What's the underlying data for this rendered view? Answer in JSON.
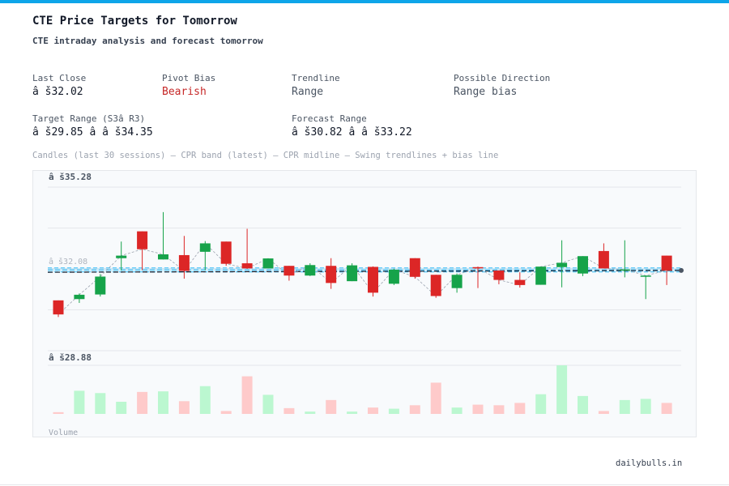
{
  "header": {
    "title": "CTE Price Targets for Tomorrow",
    "subtitle": "CTE intraday analysis and forecast tomorrow"
  },
  "stats": {
    "last_close_label": "Last Close",
    "last_close_value": "â š32.02",
    "pivot_bias_label": "Pivot Bias",
    "pivot_bias_value": "Bearish",
    "trendline_label": "Trendline",
    "trendline_value": "Range",
    "direction_label": "Possible Direction",
    "direction_value": "Range bias",
    "target_range_label": "Target Range (S3â  R3)",
    "target_range_value": "â š29.85 â   â š34.35",
    "forecast_range_label": "Forecast Range",
    "forecast_range_value": "â š30.82 â   â š33.22"
  },
  "caption": "Candles (last 30 sessions) – CPR band (latest) – CPR midline – Swing trendlines + bias line",
  "footer": "dailybulls.in",
  "colors": {
    "up": "#16a34a",
    "down": "#dc2626",
    "up_volume": "#bbf7d0",
    "down_volume": "#fecaca",
    "cpr": "#38bdf8",
    "accent": "#0ea5e9"
  },
  "chart_data": {
    "type": "candlestick",
    "y_top_label": "â š35.28",
    "y_bottom_label": "â š28.88",
    "ylim": [
      28.88,
      35.28
    ],
    "last_price_label": "â š32.08",
    "volume_label": "Volume",
    "grid": true,
    "cpr_band": [
      31.96,
      32.12
    ],
    "cpr_mid": 32.04,
    "bias_line": [
      31.95,
      32.02
    ],
    "candles": [
      {
        "o": 30.85,
        "h": 30.68,
        "l": 30.2,
        "c": 30.3,
        "v": 3
      },
      {
        "o": 30.9,
        "h": 31.12,
        "l": 30.75,
        "c": 31.07,
        "v": 40
      },
      {
        "o": 31.08,
        "h": 31.88,
        "l": 31.0,
        "c": 31.78,
        "v": 36
      },
      {
        "o": 32.5,
        "h": 33.15,
        "l": 32.02,
        "c": 32.6,
        "v": 21
      },
      {
        "o": 33.55,
        "h": 33.55,
        "l": 32.03,
        "c": 32.85,
        "v": 38
      },
      {
        "o": 32.45,
        "h": 34.3,
        "l": 32.45,
        "c": 32.65,
        "v": 39
      },
      {
        "o": 32.62,
        "h": 33.37,
        "l": 31.7,
        "c": 32.0,
        "v": 22
      },
      {
        "o": 32.75,
        "h": 33.17,
        "l": 32.03,
        "c": 33.08,
        "v": 48
      },
      {
        "o": 33.15,
        "h": 33.15,
        "l": 32.2,
        "c": 32.28,
        "v": 5
      },
      {
        "o": 32.3,
        "h": 33.65,
        "l": 32.08,
        "c": 32.1,
        "v": 65
      },
      {
        "o": 32.1,
        "h": 32.49,
        "l": 32.1,
        "c": 32.49,
        "v": 33
      },
      {
        "o": 32.2,
        "h": 32.2,
        "l": 31.62,
        "c": 31.82,
        "v": 10
      },
      {
        "o": 31.82,
        "h": 32.3,
        "l": 31.8,
        "c": 32.23,
        "v": 4
      },
      {
        "o": 32.2,
        "h": 32.5,
        "l": 31.3,
        "c": 31.53,
        "v": 24
      },
      {
        "o": 31.6,
        "h": 32.3,
        "l": 31.6,
        "c": 32.22,
        "v": 4
      },
      {
        "o": 32.16,
        "h": 32.18,
        "l": 31.0,
        "c": 31.15,
        "v": 11
      },
      {
        "o": 31.5,
        "h": 32.09,
        "l": 31.45,
        "c": 32.05,
        "v": 9
      },
      {
        "o": 32.5,
        "h": 32.5,
        "l": 31.7,
        "c": 31.77,
        "v": 15
      },
      {
        "o": 31.85,
        "h": 31.85,
        "l": 30.95,
        "c": 31.02,
        "v": 54
      },
      {
        "o": 31.33,
        "h": 31.9,
        "l": 31.15,
        "c": 31.85,
        "v": 11
      },
      {
        "o": 32.15,
        "h": 32.17,
        "l": 31.33,
        "c": 32.12,
        "v": 16
      },
      {
        "o": 32.02,
        "h": 32.02,
        "l": 31.48,
        "c": 31.65,
        "v": 15
      },
      {
        "o": 31.65,
        "h": 31.95,
        "l": 31.35,
        "c": 31.45,
        "v": 19
      },
      {
        "o": 31.46,
        "h": 32.17,
        "l": 31.46,
        "c": 32.17,
        "v": 34
      },
      {
        "o": 32.15,
        "h": 33.2,
        "l": 31.36,
        "c": 32.32,
        "v": 84
      },
      {
        "o": 31.9,
        "h": 32.58,
        "l": 31.8,
        "c": 32.58,
        "v": 31
      },
      {
        "o": 32.78,
        "h": 33.08,
        "l": 32.12,
        "c": 32.1,
        "v": 5
      },
      {
        "o": 32.06,
        "h": 33.2,
        "l": 31.75,
        "c": 32.06,
        "v": 24
      },
      {
        "o": 31.82,
        "h": 31.77,
        "l": 30.9,
        "c": 31.82,
        "v": 26
      },
      {
        "o": 32.6,
        "h": 32.6,
        "l": 31.45,
        "c": 32.02,
        "v": 19
      }
    ]
  }
}
